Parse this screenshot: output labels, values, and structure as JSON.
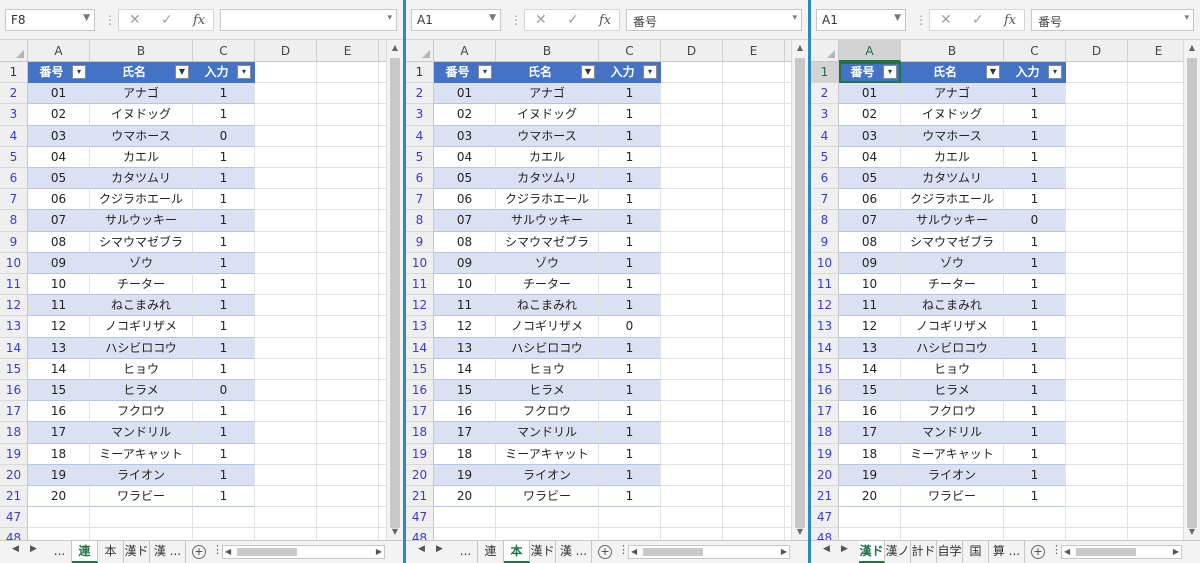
{
  "headers": [
    "番号",
    "氏名",
    "入力"
  ],
  "columns": [
    "A",
    "B",
    "C",
    "D",
    "E"
  ],
  "row_numbers": [
    "1",
    "2",
    "3",
    "4",
    "5",
    "6",
    "7",
    "8",
    "9",
    "10",
    "11",
    "12",
    "13",
    "14",
    "15",
    "16",
    "17",
    "18",
    "19",
    "20",
    "21",
    "47",
    "48"
  ],
  "ids": [
    "01",
    "02",
    "03",
    "04",
    "05",
    "06",
    "07",
    "08",
    "09",
    "10",
    "11",
    "12",
    "13",
    "14",
    "15",
    "16",
    "17",
    "18",
    "19",
    "20"
  ],
  "names": [
    "アナゴ",
    "イヌドッグ",
    "ウマホース",
    "カエル",
    "カタツムリ",
    "クジラホエール",
    "サルウッキー",
    "シマウマゼブラ",
    "ゾウ",
    "チーター",
    "ねこまみれ",
    "ノコギリザメ",
    "ハシビロコウ",
    "ヒョウ",
    "ヒラメ",
    "フクロウ",
    "マンドリル",
    "ミーアキャット",
    "ライオン",
    "ワラビー"
  ],
  "windows": [
    {
      "name_box": "F8",
      "formula": "",
      "inputs": [
        "1",
        "1",
        "0",
        "1",
        "1",
        "1",
        "1",
        "1",
        "1",
        "1",
        "1",
        "1",
        "1",
        "1",
        "0",
        "1",
        "1",
        "1",
        "1",
        "1"
      ],
      "filter_icons": [
        "▾⃨",
        "⊻",
        "▾"
      ],
      "tabs": [
        "...",
        "連",
        "本",
        "漢ド",
        "漢 ..."
      ],
      "active_tab": "連",
      "selected": false
    },
    {
      "name_box": "A1",
      "formula": "番号",
      "inputs": [
        "1",
        "1",
        "1",
        "1",
        "1",
        "1",
        "1",
        "1",
        "1",
        "1",
        "1",
        "0",
        "1",
        "1",
        "1",
        "1",
        "1",
        "1",
        "1",
        "1"
      ],
      "filter_icons": [
        "▾⃨",
        "⊻",
        "▾"
      ],
      "tabs": [
        "...",
        "連",
        "本",
        "漢ド",
        "漢 ..."
      ],
      "active_tab": "本",
      "selected": false
    },
    {
      "name_box": "A1",
      "formula": "番号",
      "inputs": [
        "1",
        "1",
        "1",
        "1",
        "1",
        "1",
        "0",
        "1",
        "1",
        "1",
        "1",
        "1",
        "1",
        "1",
        "1",
        "1",
        "1",
        "1",
        "1",
        "1"
      ],
      "filter_icons": [
        "▾⃨",
        "⊻",
        "▾"
      ],
      "tabs": [
        "漢ド",
        "漢ノ",
        "計ド",
        "自学",
        "国",
        "算 ..."
      ],
      "active_tab": "漢ド",
      "selected": true
    }
  ],
  "icons": {
    "cancel": "close-icon",
    "enter": "check-icon",
    "function": "fx-icon"
  },
  "colors": {
    "table_header": "#4472c4",
    "band": "#d9e1f2",
    "excel_green": "#217346",
    "row_number": "#3a3ad0",
    "window_gap": "#2a8ab8"
  }
}
